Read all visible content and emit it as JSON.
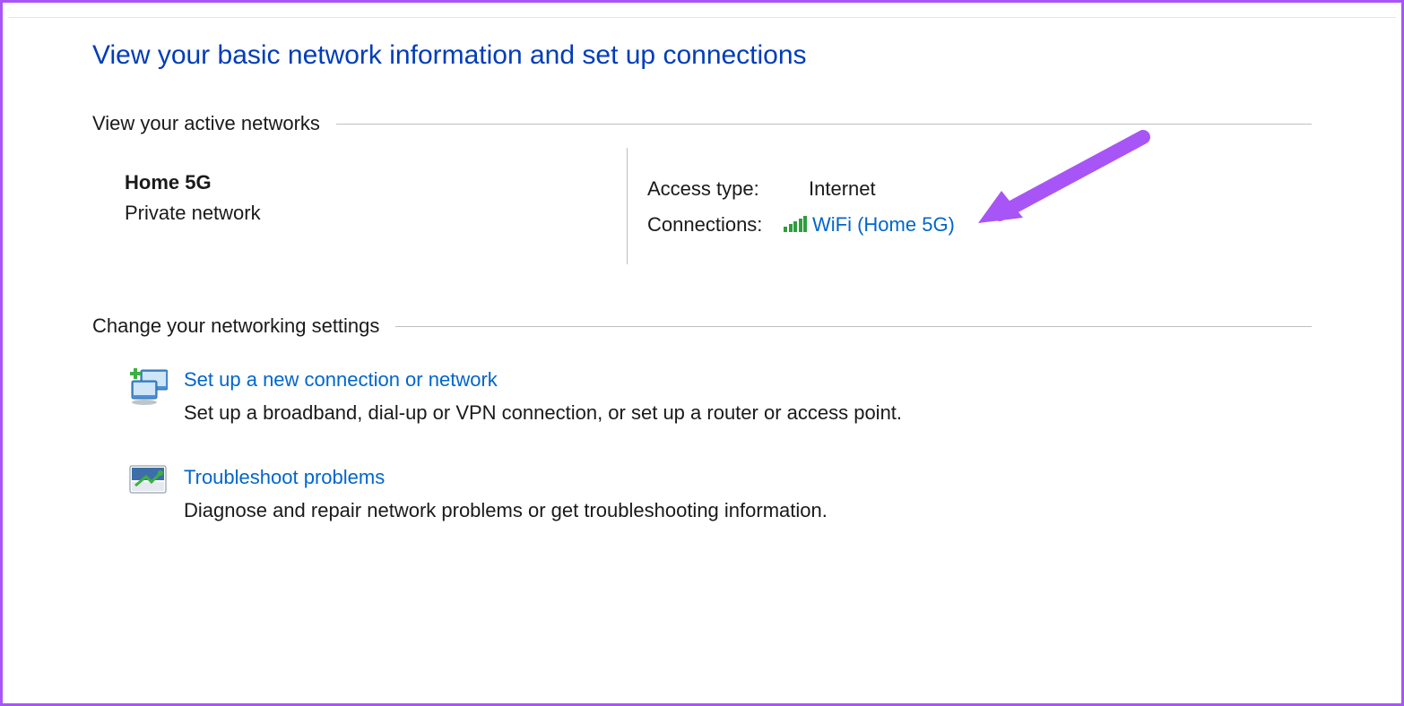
{
  "page": {
    "title": "View your basic network information and set up connections"
  },
  "active_networks": {
    "section_label": "View your active networks",
    "network_name": "Home 5G",
    "network_type": "Private network",
    "access_type_label": "Access type:",
    "access_type_value": "Internet",
    "connections_label": "Connections:",
    "connection_link": "WiFi (Home 5G)"
  },
  "change_settings": {
    "section_label": "Change your networking settings",
    "items": [
      {
        "link": "Set up a new connection or network",
        "desc": "Set up a broadband, dial-up or VPN connection, or set up a router or access point."
      },
      {
        "link": "Troubleshoot problems",
        "desc": "Diagnose and repair network problems or get troubleshooting information."
      }
    ]
  }
}
